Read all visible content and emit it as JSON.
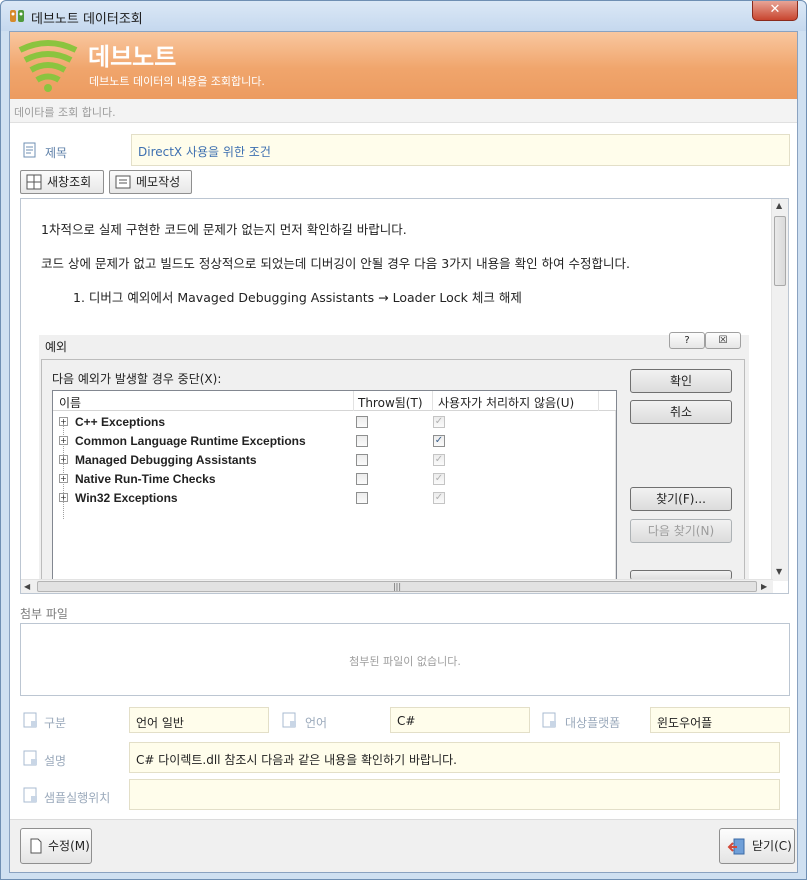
{
  "window": {
    "title": "데브노트 데이터조회",
    "close_label": "✕"
  },
  "banner": {
    "title": "데브노트",
    "subtitle": "데브노트 데이터의 내용을 조회합니다."
  },
  "hint": "데이타를 조회 합니다.",
  "subject": {
    "label": "제목",
    "value": "DirectX 사용을 위한 조건"
  },
  "toolbar": {
    "new_view": "새창조회",
    "memo": "메모작성"
  },
  "content": {
    "line1": "1차적으로 실제 구현한 코드에 문제가 없는지 먼저 확인하길 바랍니다.",
    "line2": "코드 상에 문제가 없고 빌드도 정상적으로 되었는데 디버깅이 안될 경우 다음 3가지 내용을 확인 하여 수정합니다.",
    "line3": "1. 디버그 예외에서 Mavaged Debugging Assistants → Loader Lock 체크 해제"
  },
  "dialog": {
    "title": "예외",
    "help_label": "?",
    "close_label": "☒",
    "prompt": "다음 예외가 발생할 경우 중단(X):",
    "columns": {
      "name": "이름",
      "thrown": "Throw됨(T)",
      "unhandled": "사용자가 처리하지 않음(U)"
    },
    "rows": [
      {
        "name": "C++ Exceptions",
        "thrown": false,
        "unhandled": true
      },
      {
        "name": "Common Language Runtime Exceptions",
        "thrown": false,
        "unhandled": true
      },
      {
        "name": "Managed Debugging Assistants",
        "thrown": false,
        "unhandled": true
      },
      {
        "name": "Native Run-Time Checks",
        "thrown": false,
        "unhandled": true
      },
      {
        "name": "Win32 Exceptions",
        "thrown": false,
        "unhandled": true
      }
    ],
    "buttons": {
      "ok": "확인",
      "cancel": "취소",
      "find": "찾기(F)...",
      "find_next": "다음 찾기(N)"
    }
  },
  "attachments": {
    "label": "첨부 파일",
    "empty_text": "첨부된 파일이 없습니다."
  },
  "meta": {
    "category_label": "구분",
    "category_value": "언어 일반",
    "language_label": "언어",
    "language_value": "C#",
    "platform_label": "대상플랫폼",
    "platform_value": "윈도우어플",
    "description_label": "설명",
    "description_value": "C# 다이렉트.dll 참조시 다음과 같은 내용을 확인하기 바랍니다.",
    "sample_label": "샘플실행위치",
    "sample_value": ""
  },
  "footer": {
    "edit_label": "수정(M)",
    "close_label": "닫기(C)"
  },
  "colors": {
    "banner": "#f0a56c",
    "field_bg": "#fffdeb",
    "label_blue": "#5d7fa8"
  }
}
